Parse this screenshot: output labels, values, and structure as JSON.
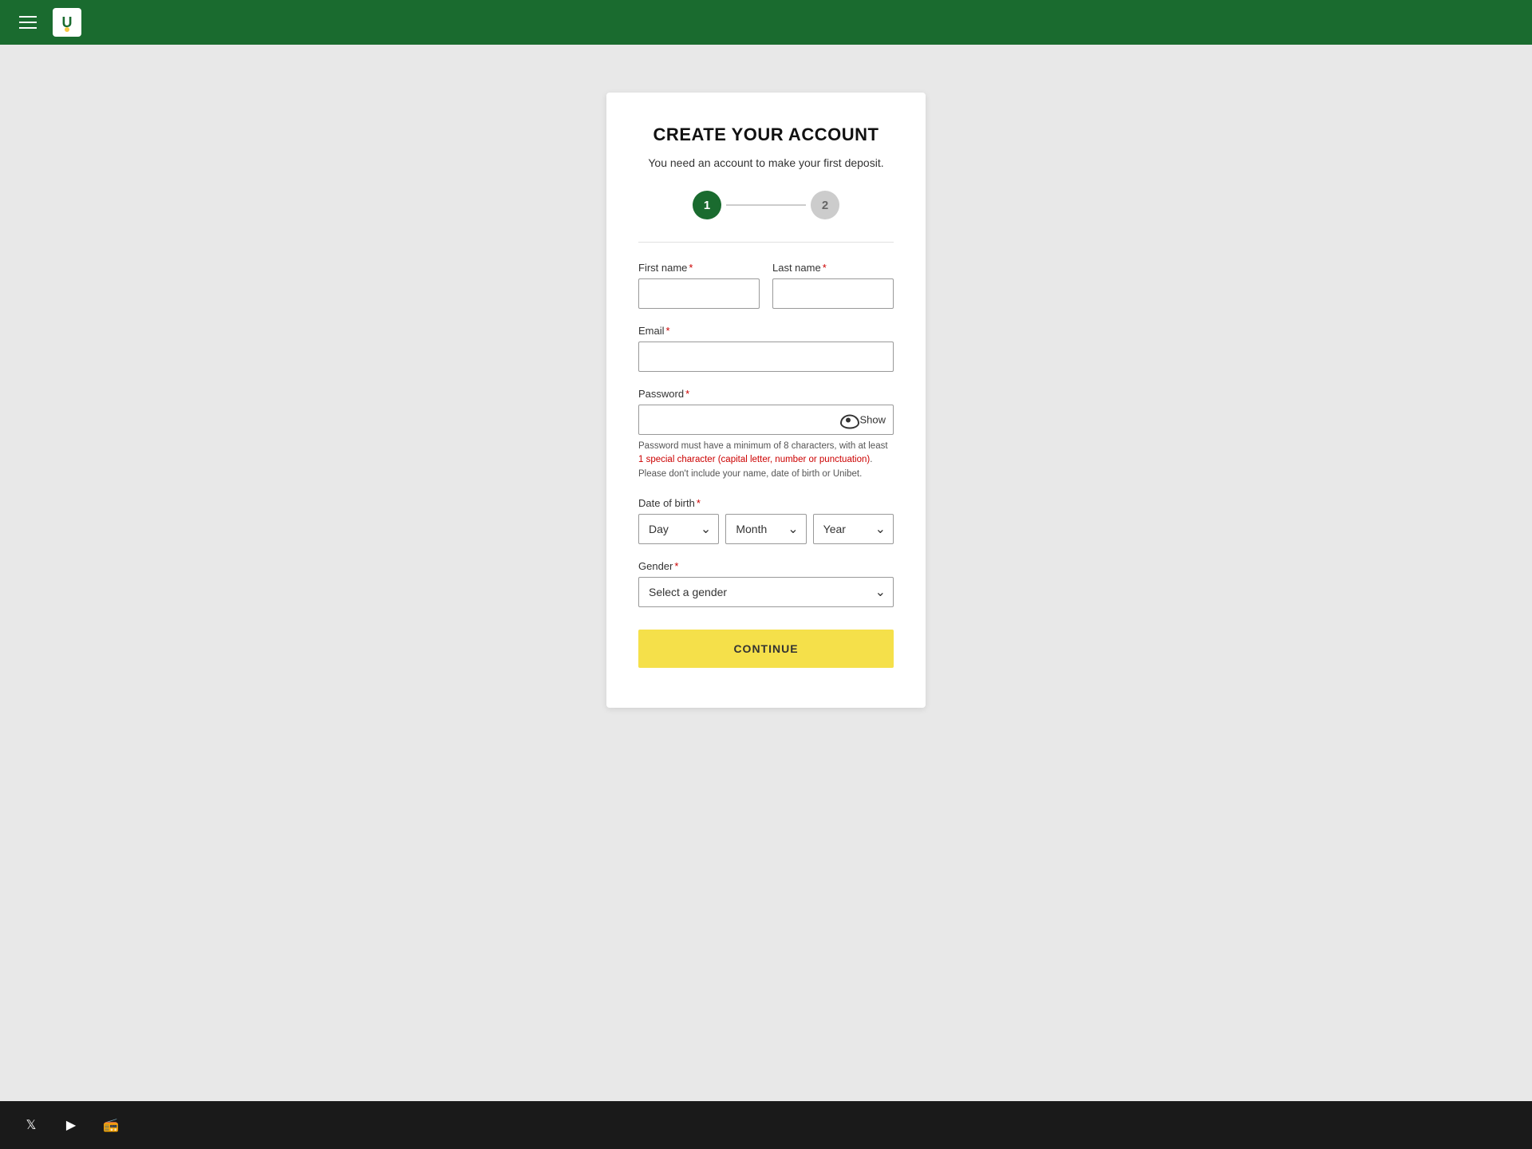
{
  "nav": {
    "hamburger_label": "Menu",
    "logo_text": "U"
  },
  "form": {
    "title": "CREATE YOUR ACCOUNT",
    "subtitle": "You need an account to make your first deposit.",
    "step1_label": "1",
    "step2_label": "2",
    "first_name_label": "First name",
    "last_name_label": "Last name",
    "email_label": "Email",
    "password_label": "Password",
    "password_show_label": "Show",
    "password_hint_part1": "Password must have a minimum of 8 characters, with at least ",
    "password_hint_highlight": "1 special character (capital letter, number or punctuation)",
    "password_hint_part2": ". Please don't include your name, date of birth or Unibet.",
    "dob_label": "Date of birth",
    "day_placeholder": "Day",
    "month_placeholder": "Month",
    "year_placeholder": "Year",
    "gender_label": "Gender",
    "gender_placeholder": "Select a gender",
    "continue_label": "CONTINUE"
  },
  "footer": {
    "social_icons": [
      "X",
      "▶",
      "📻"
    ]
  }
}
